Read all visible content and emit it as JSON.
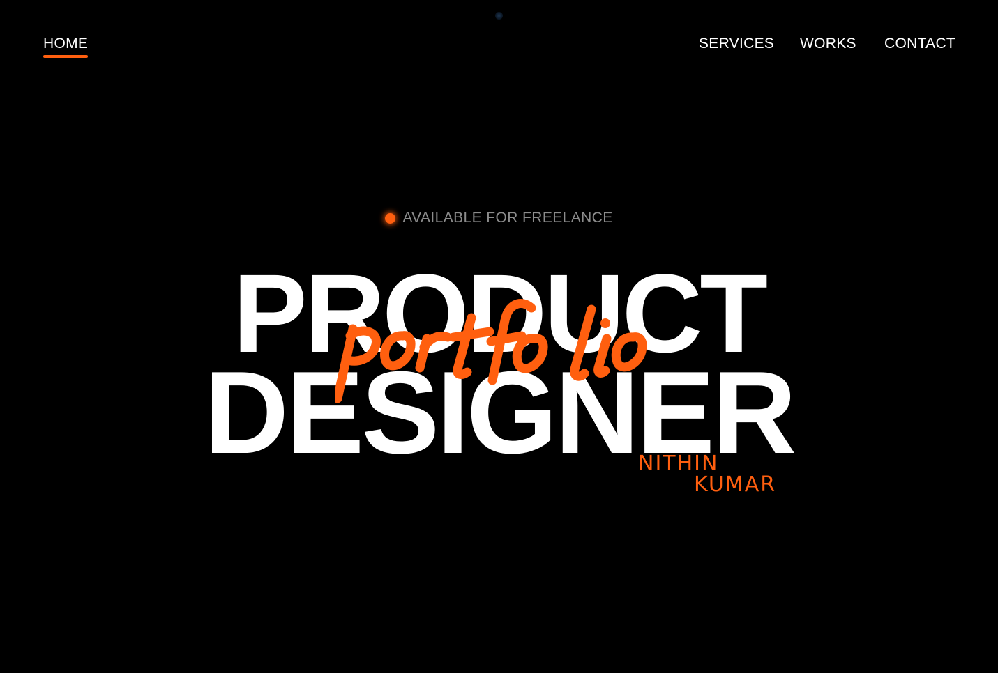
{
  "colors": {
    "background": "#000000",
    "accent": "#ff5f0f",
    "text_primary": "#ffffff",
    "text_muted": "#8c8c8c"
  },
  "nav": {
    "home": "HOME",
    "services": "SERVICES",
    "works": "WORKS",
    "contact": "CONTACT",
    "active": "HOME"
  },
  "hero": {
    "availability_icon": "status-dot-icon",
    "availability_text": "AVAILABLE FOR FREELANCE",
    "headline_line1": "PRODUCT",
    "headline_line2": "DESIGNER",
    "script_word": "portfolio",
    "name_first": "NITHIN",
    "name_last": "KUMAR"
  }
}
